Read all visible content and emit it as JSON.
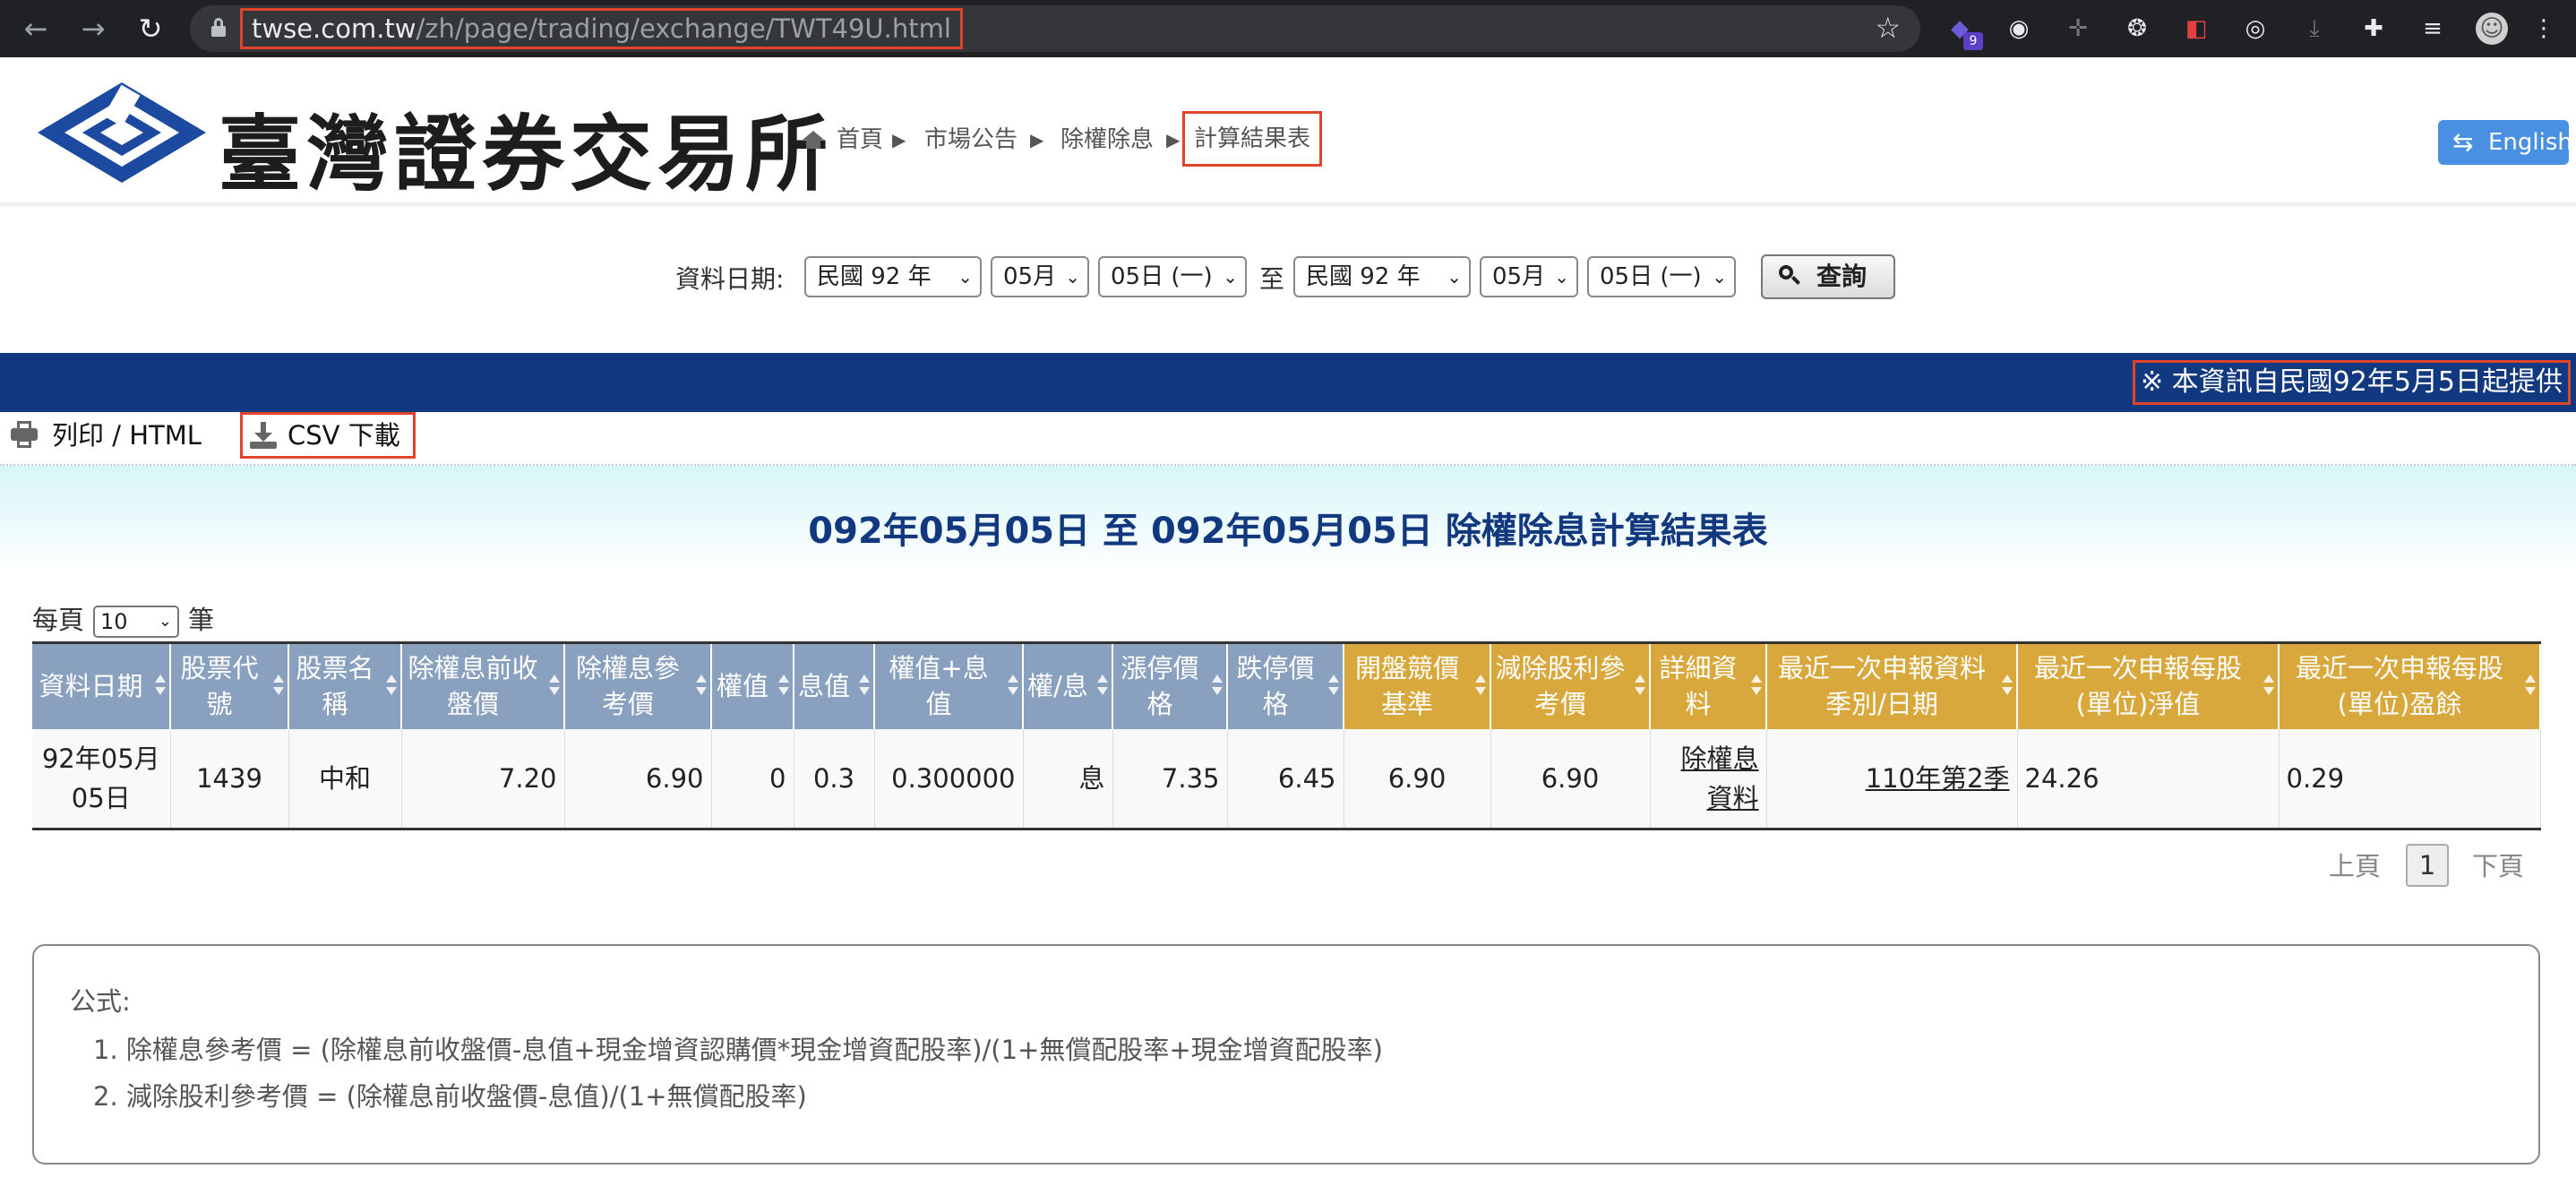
{
  "browser": {
    "url_host": "twse.com.tw",
    "url_path": "/zh/page/trading/exchange/TWT49U.html",
    "badge": "9"
  },
  "header": {
    "logo_text": "臺灣證券交易所",
    "breadcrumb": [
      "首頁",
      "市場公告",
      "除權除息",
      "計算結果表"
    ],
    "lang_button": "English",
    "colors": {
      "brand_blue": "#12387f",
      "accent_gold": "#d9a83c",
      "header_blue": "#8aa0bf",
      "highlight": "#e0452c"
    }
  },
  "query": {
    "label": "資料日期:",
    "start_year": "民國 92 年",
    "start_month": "05月",
    "start_day": "05日 (一)",
    "to": "至",
    "end_year": "民國 92 年",
    "end_month": "05月",
    "end_day": "05日 (一)",
    "search_button": "查詢"
  },
  "notice": "※ 本資訊自民國92年5月5日起提供",
  "toolbar": {
    "print": "列印 / HTML",
    "csv": "CSV 下載"
  },
  "report": {
    "title": "092年05月05日 至 092年05月05日 除權除息計算結果表",
    "per_page_label": "每頁",
    "per_page_value": "10",
    "per_page_unit": "筆"
  },
  "table": {
    "headers": [
      "資料日期",
      "股票代號",
      "股票名稱",
      "除權息前收盤價",
      "除權息參考價",
      "權值",
      "息值",
      "權值+息值",
      "權/息",
      "漲停價格",
      "跌停價格",
      "開盤競價基準",
      "減除股利參考價",
      "詳細資料",
      "最近一次申報資料 季別/日期",
      "最近一次申報每股(單位)淨值",
      "最近一次申報每股(單位)盈餘"
    ],
    "rows": [
      [
        "92年05月05日",
        "1439",
        "中和",
        "7.20",
        "6.90",
        "0",
        "0.3",
        "0.300000",
        "息",
        "7.35",
        "6.45",
        "6.90",
        "6.90",
        "除權息資料",
        "110年第2季",
        "24.26",
        "0.29"
      ]
    ]
  },
  "pagination": {
    "prev": "上頁",
    "current": "1",
    "next": "下頁"
  },
  "formula": {
    "title": "公式:",
    "items": [
      "1. 除權息參考價 = (除權息前收盤價-息值+現金增資認購價*現金增資配股率)/(1+無償配股率+現金增資配股率)",
      "2. 減除股利參考價 = (除權息前收盤價-息值)/(1+無償配股率)"
    ]
  }
}
